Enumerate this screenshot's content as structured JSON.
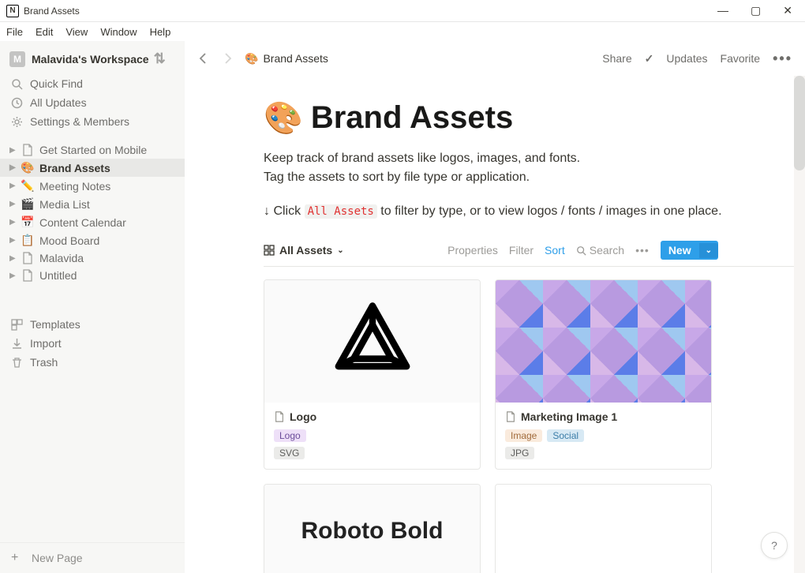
{
  "window": {
    "title": "Brand Assets"
  },
  "menu": [
    "File",
    "Edit",
    "View",
    "Window",
    "Help"
  ],
  "workspace": {
    "initial": "M",
    "name": "Malavida's Workspace"
  },
  "quick": [
    {
      "icon": "search",
      "label": "Quick Find"
    },
    {
      "icon": "clock",
      "label": "All Updates"
    },
    {
      "icon": "gear",
      "label": "Settings & Members"
    }
  ],
  "pages": [
    {
      "emoji": "📄",
      "label": "Get Started on Mobile",
      "active": false,
      "gray": true
    },
    {
      "emoji": "🎨",
      "label": "Brand Assets",
      "active": true
    },
    {
      "emoji": "✏️",
      "label": "Meeting Notes",
      "active": false
    },
    {
      "emoji": "🎬",
      "label": "Media List",
      "active": false
    },
    {
      "emoji": "📅",
      "label": "Content Calendar",
      "active": false
    },
    {
      "emoji": "📋",
      "label": "Mood Board",
      "active": false
    },
    {
      "emoji": "📄",
      "label": "Malavida",
      "active": false,
      "gray": true
    },
    {
      "emoji": "📄",
      "label": "Untitled",
      "active": false,
      "gray": true
    }
  ],
  "tools": [
    {
      "icon": "template",
      "label": "Templates"
    },
    {
      "icon": "import",
      "label": "Import"
    },
    {
      "icon": "trash",
      "label": "Trash"
    }
  ],
  "newpage": "New Page",
  "topbar": {
    "crumb": "Brand Assets",
    "share": "Share",
    "updates": "Updates",
    "favorite": "Favorite"
  },
  "page": {
    "emoji": "🎨",
    "title": "Brand Assets",
    "desc1": "Keep track of brand assets like logos, images, and fonts.",
    "desc2": "Tag the assets to sort by file type or application.",
    "hint_pre": "↓ Click ",
    "hint_code": "All Assets",
    "hint_post": " to filter by type, or to view logos / fonts / images in one place."
  },
  "db": {
    "view": "All Assets",
    "properties": "Properties",
    "filter": "Filter",
    "sort": "Sort",
    "search": "Search",
    "new": "New"
  },
  "cards": [
    {
      "title": "Logo",
      "tags": [
        {
          "text": "Logo",
          "cls": "purple"
        }
      ],
      "format": "SVG",
      "type": "logo"
    },
    {
      "title": "Marketing Image 1",
      "tags": [
        {
          "text": "Image",
          "cls": "orange"
        },
        {
          "text": "Social",
          "cls": "blue"
        }
      ],
      "format": "JPG",
      "type": "image"
    },
    {
      "title": "Roboto Bold",
      "tags": [],
      "format": "",
      "type": "font"
    }
  ]
}
